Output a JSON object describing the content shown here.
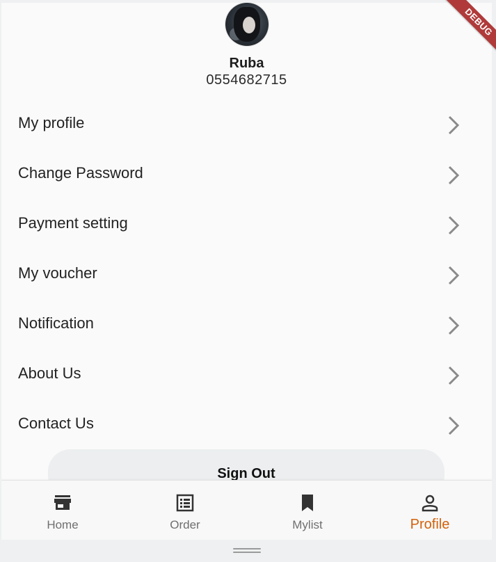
{
  "profile": {
    "name": "Ruba",
    "phone": "0554682715"
  },
  "menu": {
    "items": [
      {
        "label": "My profile"
      },
      {
        "label": "Change Password"
      },
      {
        "label": "Payment setting"
      },
      {
        "label": "My voucher"
      },
      {
        "label": "Notification"
      },
      {
        "label": "About Us"
      },
      {
        "label": "Contact Us"
      }
    ],
    "chevron_icon": "chevron-right-icon"
  },
  "sign_out": {
    "label": "Sign Out"
  },
  "bottom_nav": {
    "items": [
      {
        "label": "Home",
        "icon": "store-icon",
        "active": false
      },
      {
        "label": "Order",
        "icon": "list-icon",
        "active": false
      },
      {
        "label": "Mylist",
        "icon": "bookmark-icon",
        "active": false
      },
      {
        "label": "Profile",
        "icon": "person-icon",
        "active": true
      }
    ],
    "active_color": "#d2610a",
    "inactive_color": "#6f6f6f"
  },
  "debug_banner": {
    "label": "DEBUG",
    "color": "#b03a3a"
  }
}
